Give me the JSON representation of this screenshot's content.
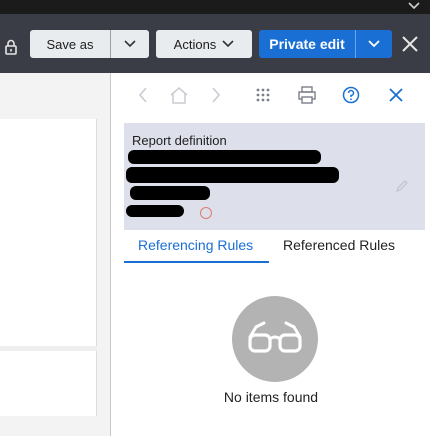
{
  "toolbar": {
    "save_as_label": "Save as",
    "actions_label": "Actions",
    "private_edit_label": "Private edit",
    "colors": {
      "bar": "#3a3d46",
      "primary": "#1a6fd4",
      "secondary": "#e9ecef"
    }
  },
  "panel": {
    "nav_icons": [
      "chevron-left-icon",
      "home-icon",
      "chevron-right-icon",
      "grid-icon",
      "print-icon",
      "help-icon",
      "close-icon"
    ],
    "record_type": "Report definition",
    "tabs": [
      {
        "label": "Referencing Rules",
        "active": true
      },
      {
        "label": "Referenced Rules",
        "active": false
      }
    ],
    "empty_state": {
      "icon": "glasses-icon",
      "message": "No items found"
    }
  }
}
